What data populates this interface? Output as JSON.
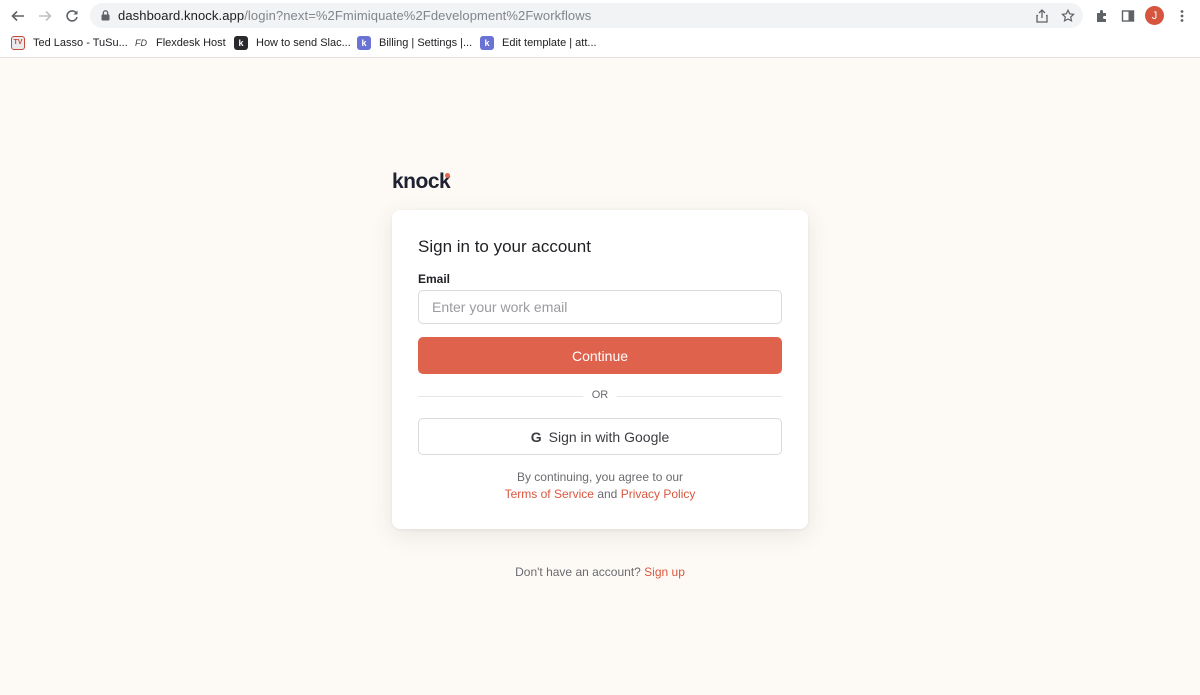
{
  "browser": {
    "url_host": "dashboard.knock.app",
    "url_path": "/login?next=%2Fmimiquate%2Fdevelopment%2Fworkflows",
    "avatar_initial": "J",
    "avatar_color": "#d5553f"
  },
  "bookmarks": [
    {
      "label": "Ted Lasso - TuSu...",
      "icon": "tv-icon"
    },
    {
      "label": "Flexdesk Host",
      "icon": "flexdesk-icon"
    },
    {
      "label": "How to send Slac...",
      "icon": "knock-k-icon"
    },
    {
      "label": "Billing | Settings |...",
      "icon": "knock-k-icon"
    },
    {
      "label": "Edit template | att...",
      "icon": "knock-k-icon"
    }
  ],
  "page": {
    "logo_text": "knock",
    "title": "Sign in to your account",
    "email_label": "Email",
    "email_placeholder": "Enter your work email",
    "email_value": "",
    "continue_label": "Continue",
    "or_label": "OR",
    "google_label": "Sign in with Google",
    "terms_prefix": "By continuing, you agree to our",
    "terms_link": "Terms of Service",
    "terms_and": "and",
    "privacy_link": "Privacy Policy",
    "signup_prompt": "Don't have an account?",
    "signup_link": "Sign up"
  },
  "colors": {
    "accent": "#df624c",
    "background": "#fdfaf6"
  }
}
